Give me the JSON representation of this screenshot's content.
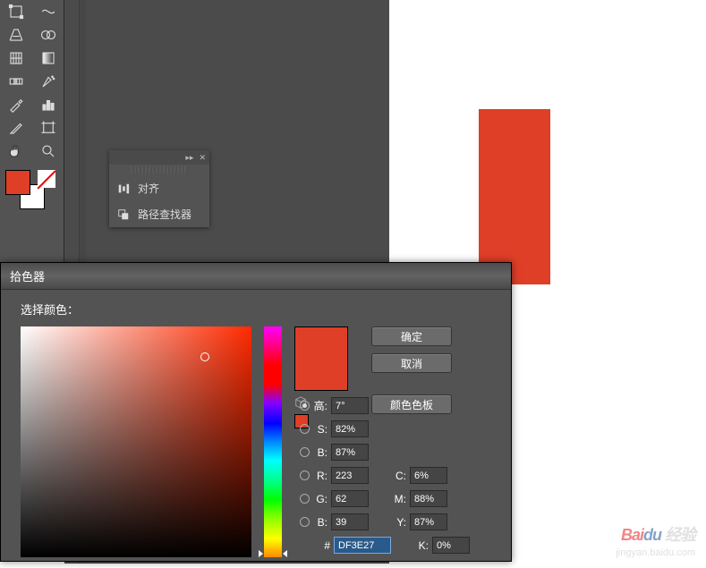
{
  "float_panel": {
    "align_label": "对齐",
    "pathfinder_label": "路径查找器"
  },
  "picker": {
    "title": "拾色器",
    "select_label": "选择颜色：",
    "ok": "确定",
    "cancel": "取消",
    "swatches": "颜色色板",
    "hsb": {
      "h_label": "高:",
      "h": "7°",
      "s_label": "S:",
      "s": "82%",
      "b_label": "B:",
      "b": "87%"
    },
    "rgb": {
      "r_label": "R:",
      "r": "223",
      "g_label": "G:",
      "g": "62",
      "b_label": "B:",
      "b": "39"
    },
    "cmyk": {
      "c_label": "C:",
      "c": "6%",
      "m_label": "M:",
      "m": "88%",
      "y_label": "Y:",
      "y": "87%",
      "k_label": "K:",
      "k": "0%"
    },
    "hex_prefix": "#",
    "hex": "DF3E27"
  },
  "colors": {
    "current": "#df3e27"
  },
  "watermark": {
    "brand": "Baidu 经验",
    "url": "jingyan.baidu.com"
  }
}
